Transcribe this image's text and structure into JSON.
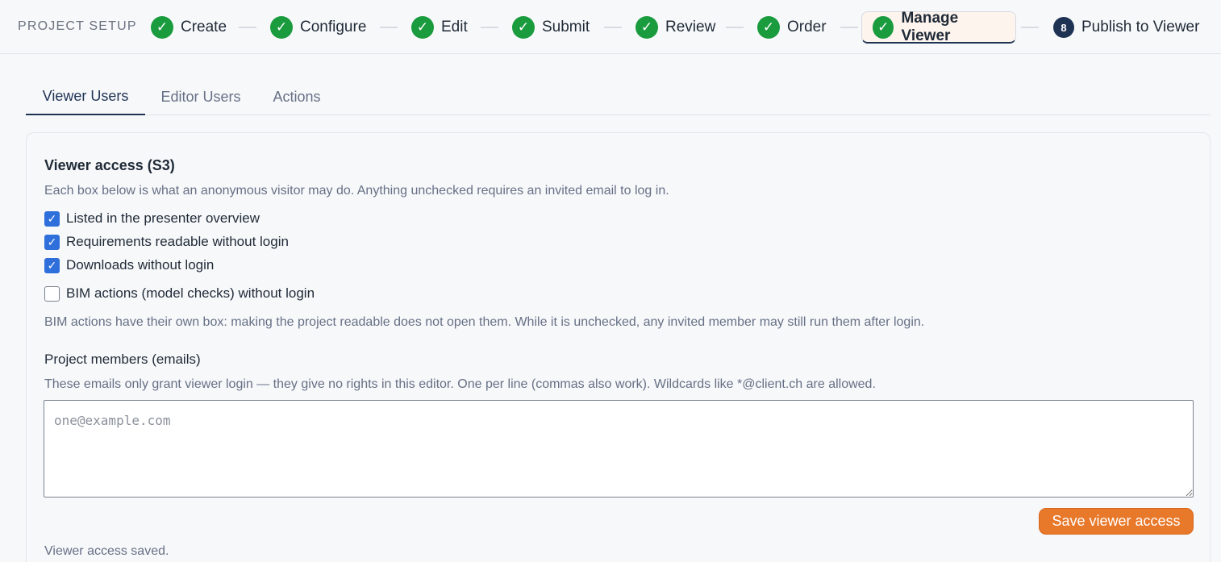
{
  "stepper": {
    "label": "PROJECT SETUP",
    "steps": [
      {
        "label": "Create",
        "state": "done"
      },
      {
        "label": "Configure",
        "state": "done"
      },
      {
        "label": "Edit",
        "state": "done"
      },
      {
        "label": "Submit",
        "state": "done"
      },
      {
        "label": "Review",
        "state": "done"
      },
      {
        "label": "Order",
        "state": "done"
      },
      {
        "label": "Manage Viewer",
        "state": "active"
      },
      {
        "label": "Publish to Viewer",
        "state": "pending",
        "number": "8"
      }
    ],
    "check_glyph": "✓"
  },
  "tabs": [
    {
      "label": "Viewer Users",
      "active": true
    },
    {
      "label": "Editor Users",
      "active": false
    },
    {
      "label": "Actions",
      "active": false
    }
  ],
  "viewer_access": {
    "title": "Viewer access (S3)",
    "description": "Each box below is what an anonymous visitor may do. Anything unchecked requires an invited email to log in.",
    "options": [
      {
        "label": "Listed in the presenter overview",
        "checked": true
      },
      {
        "label": "Requirements readable without login",
        "checked": true
      },
      {
        "label": "Downloads without login",
        "checked": true
      },
      {
        "label": "BIM actions (model checks) without login",
        "checked": false
      }
    ],
    "bim_note": "BIM actions have their own box: making the project readable does not open them. While it is unchecked, any invited member may still run them after login.",
    "members_label": "Project members (emails)",
    "members_help": "These emails only grant viewer login — they give no rights in this editor. One per line (commas also work). Wildcards like *@client.ch are allowed.",
    "members_value": "",
    "members_placeholder": "one@example.com",
    "save_label": "Save viewer access",
    "status": "Viewer access saved."
  },
  "colors": {
    "accent": "#e8782a",
    "navy": "#1e3354",
    "success": "#1a9b3e",
    "checkbox": "#2f6fdb"
  }
}
